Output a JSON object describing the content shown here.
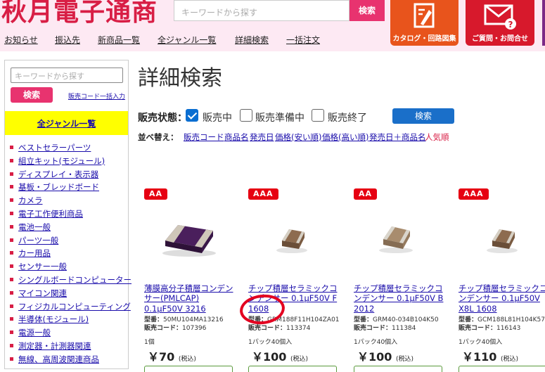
{
  "header": {
    "logo": "秋月電子通商",
    "search_placeholder": "キーワードから探す",
    "search_button": "検索",
    "catalog_label": "カタログ・回路図集",
    "contact_label": "ご質問・お問合せ",
    "nav": [
      "お知らせ",
      "振込先",
      "新商品一覧",
      "全ジャンル一覧",
      "詳細検索",
      "一括注文"
    ]
  },
  "sidebar": {
    "search_placeholder": "キーワードから探す",
    "search_button": "検索",
    "bulk_link": "販売コード一括入力",
    "all_genres": "全ジャンル一覧",
    "categories": [
      "ベストセラーパーツ",
      "組立キット(モジュール)",
      "ディスプレイ・表示器",
      "基板・ブレッドボード",
      "カメラ",
      "電子工作便利商品",
      "電池一般",
      "パーツ一般",
      "カー用品",
      "センサー一般",
      "シングルボードコンピューター",
      "マイコン関連",
      "フィジカルコンピューティング",
      "半導体(モジュール)",
      "電源一般",
      "測定器・計測器関連",
      "無線、高周波関連商品"
    ]
  },
  "main": {
    "title": "詳細検索",
    "status": {
      "label": "販売状態：",
      "options": [
        {
          "label": "販売中",
          "checked": true
        },
        {
          "label": "販売準備中",
          "checked": false
        },
        {
          "label": "販売終了",
          "checked": false
        }
      ],
      "search_button": "検索"
    },
    "sort": {
      "label": "並べ替え：",
      "options": [
        "販売コード",
        "商品名",
        "発売日",
        "価格(安い順)",
        "価格(高い順)",
        "発売日＋商品名",
        "人気順"
      ],
      "active": "人気順"
    }
  },
  "products": [
    {
      "badge": "AA",
      "name": "薄膜高分子積層コンデンサー(PMLCAP) 0.1μF50V 3216",
      "model_label": "型番：",
      "model": "50MU104MA13216",
      "code_label": "販売コード：",
      "code": "107396",
      "qty": "1個",
      "price": "￥70",
      "tax": "(税込)"
    },
    {
      "badge": "AAA",
      "name": "チップ積層セラミックコンデンサー 0.1μF50V F 1608",
      "model_label": "型番：",
      "model": "GRM188F11H104ZA01",
      "code_label": "販売コード：",
      "code": "113374",
      "qty": "1パック40個入",
      "price": "￥100",
      "tax": "(税込)"
    },
    {
      "badge": "AA",
      "name": "チップ積層セラミックコンデンサー 0.1μF50V B 2012",
      "model_label": "型番：",
      "model": "GRM40-034B104K50",
      "code_label": "販売コード：",
      "code": "111384",
      "qty": "1パック40個入",
      "price": "￥100",
      "tax": "(税込)"
    },
    {
      "badge": "AAA",
      "name": "チップ積層セラミックコンデンサー 0.1μF50V X8L 1608",
      "model_label": "型番：",
      "model": "GCM188L81H104K57",
      "code_label": "販売コード：",
      "code": "116143",
      "qty": "1パック40個入",
      "price": "￥110",
      "tax": "(税込)"
    }
  ],
  "colors": {
    "brand_red": "#d81e45",
    "pink_button": "#e8336f",
    "blue_button": "#1a6fc9",
    "yellow": "#ffff00",
    "header_bg": "#fde9f3"
  }
}
